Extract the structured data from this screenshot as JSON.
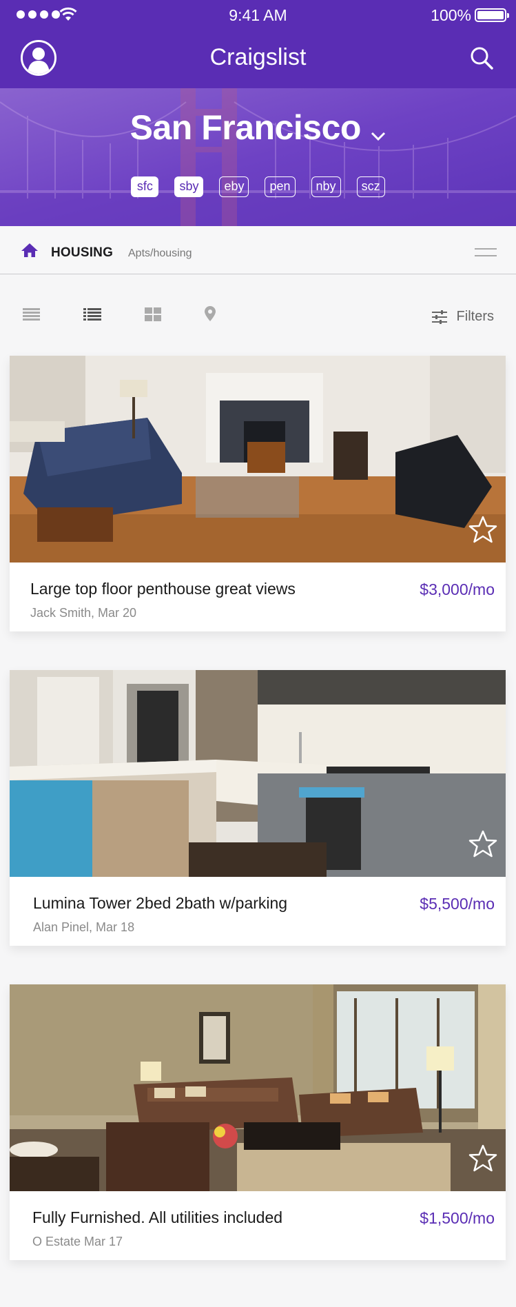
{
  "status_bar": {
    "time": "9:41 AM",
    "battery": "100%"
  },
  "header": {
    "title": "Craigslist"
  },
  "hero": {
    "city": "San Francisco",
    "regions": [
      {
        "label": "sfc",
        "selected": true
      },
      {
        "label": "sby",
        "selected": true
      },
      {
        "label": "eby",
        "selected": false
      },
      {
        "label": "pen",
        "selected": false
      },
      {
        "label": "nby",
        "selected": false
      },
      {
        "label": "scz",
        "selected": false
      }
    ]
  },
  "category": {
    "name": "HOUSING",
    "sub": "Apts/housing"
  },
  "toolbar": {
    "filters_label": "Filters"
  },
  "listings": [
    {
      "title": "Large top floor penthouse great views",
      "meta": "Jack Smith, Mar 20",
      "price": "$3,000/mo"
    },
    {
      "title": "Lumina Tower 2bed 2bath w/parking",
      "meta": "Alan Pinel, Mar 18",
      "price": "$5,500/mo"
    },
    {
      "title": "Fully Furnished. All utilities included",
      "meta": "O Estate Mar 17",
      "price": "$1,500/mo"
    }
  ],
  "colors": {
    "brand": "#5a2db4",
    "price": "#5a2db4"
  }
}
